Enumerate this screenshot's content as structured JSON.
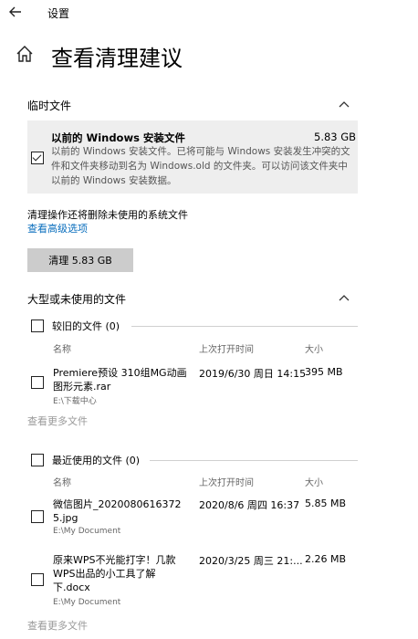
{
  "topbar": {
    "back_icon": "back-arrow-icon",
    "title": "设置"
  },
  "header": {
    "home_icon": "home-icon",
    "title": "查看清理建议"
  },
  "temp_section": {
    "title": "临时文件",
    "item": {
      "checked": true,
      "title": "以前的 Windows 安装文件",
      "size": "5.83 GB",
      "description": "以前的 Windows 安装文件。已将可能与 Windows 安装发生冲突的文件和文件夹移动到名为 Windows.old 的文件夹。可以访问该文件夹中以前的 Windows 安装数据。"
    }
  },
  "cleanup": {
    "note": "清理操作还将删除未使用的系统文件",
    "advanced_link": "查看高级选项",
    "button_label": "清理 5.83 GB"
  },
  "large_section": {
    "title": "大型或未使用的文件",
    "older": {
      "title": "较旧的文件 (0)",
      "columns": {
        "name": "名称",
        "last_opened": "上次打开时间",
        "size": "大小"
      },
      "files": [
        {
          "name": "Premiere预设 310组MG动画图形元素.rar",
          "path": "E:\\下载中心",
          "date": "2019/6/30 周日 14:15",
          "size": "395 MB"
        }
      ],
      "more": "查看更多文件"
    },
    "recent": {
      "title": "最近使用的文件 (0)",
      "columns": {
        "name": "名称",
        "last_opened": "上次打开时间",
        "size": "大小"
      },
      "files": [
        {
          "name": "微信图片_20200806163725.jpg",
          "path": "E:\\My Document",
          "date": "2020/8/6 周四 16:37",
          "size": "5.85 MB"
        },
        {
          "name": "原来WPS不光能打字！几款WPS出品的小工具了解下.docx",
          "path": "E:\\My Document",
          "date": "2020/3/25 周三 21:...",
          "size": "2.26 MB"
        }
      ],
      "more": "查看更多文件"
    }
  }
}
